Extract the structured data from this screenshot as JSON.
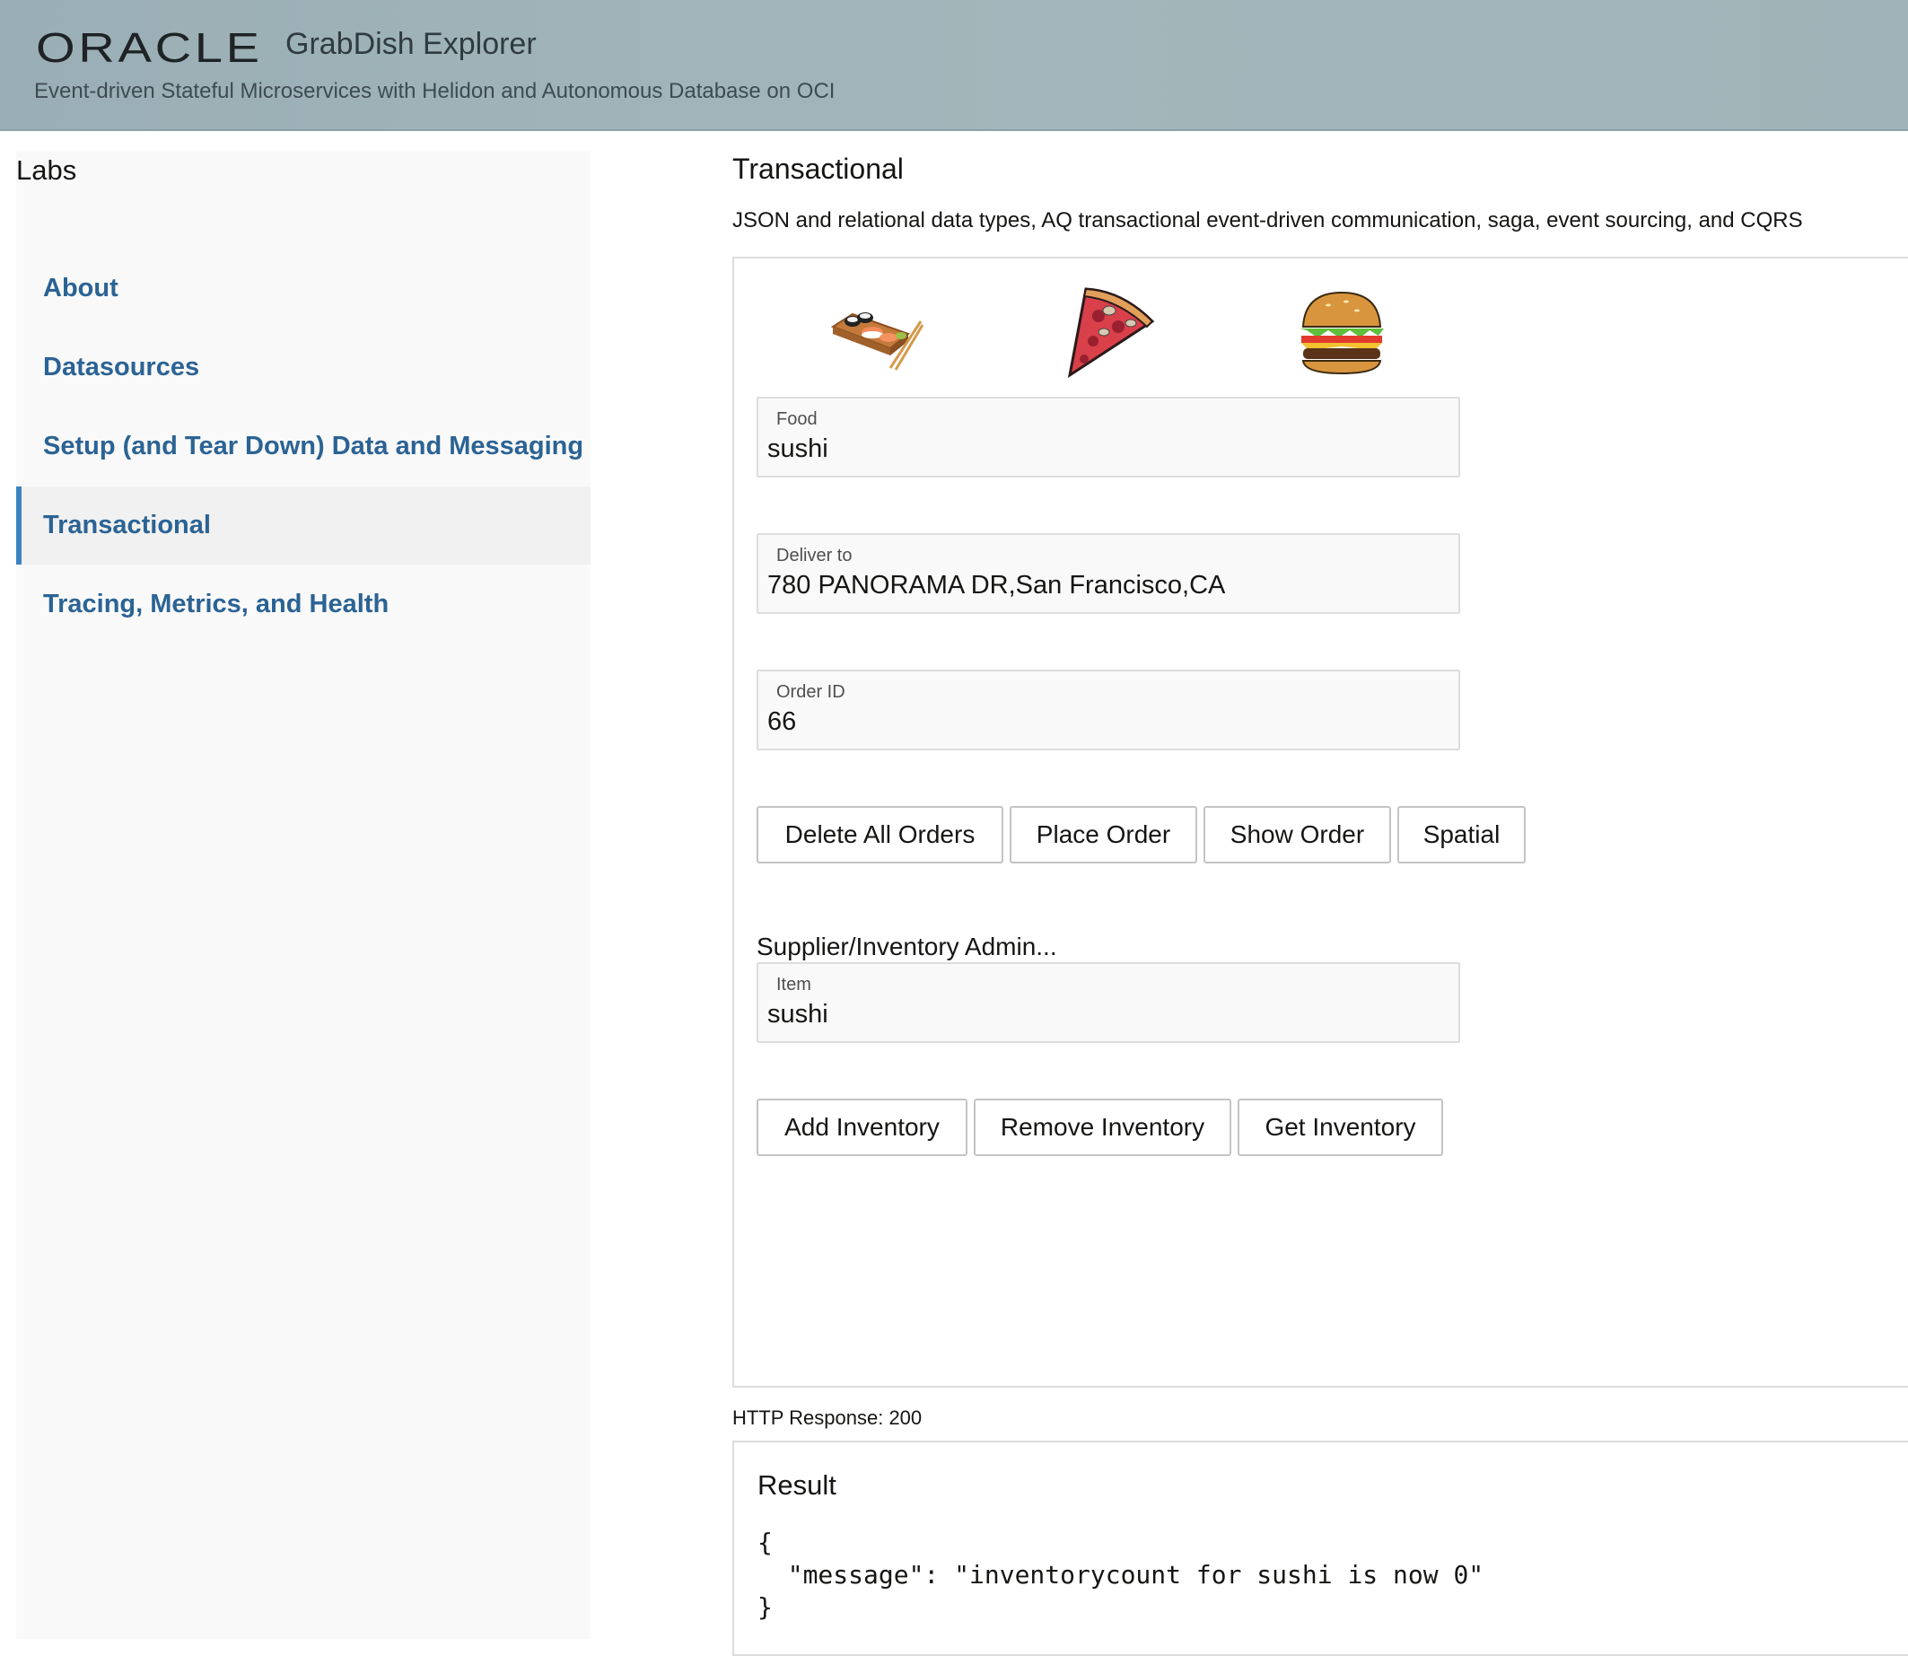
{
  "header": {
    "logo": "ORACLE",
    "app_title": "GrabDish Explorer",
    "subtitle": "Event-driven Stateful Microservices with Helidon and Autonomous Database on OCI"
  },
  "sidebar": {
    "title": "Labs",
    "items": [
      {
        "label": "About",
        "active": false
      },
      {
        "label": "Datasources",
        "active": false
      },
      {
        "label": "Setup (and Tear Down) Data and Messaging",
        "active": false
      },
      {
        "label": "Transactional",
        "active": true
      },
      {
        "label": "Tracing, Metrics, and Health",
        "active": false
      }
    ]
  },
  "main": {
    "title": "Transactional",
    "description": "JSON and relational data types, AQ transactional event-driven communication, saga, event sourcing, and CQRS",
    "food_icons": [
      "sushi-icon",
      "pizza-icon",
      "burger-icon"
    ],
    "fields": {
      "food": {
        "label": "Food",
        "value": "sushi"
      },
      "deliver_to": {
        "label": "Deliver to",
        "value": "780 PANORAMA DR,San Francisco,CA"
      },
      "order_id": {
        "label": "Order ID",
        "value": "66"
      }
    },
    "order_buttons": {
      "delete_all": "Delete All Orders",
      "place": "Place Order",
      "show": "Show Order",
      "spatial": "Spatial"
    },
    "admin": {
      "section_label": "Supplier/Inventory Admin...",
      "item": {
        "label": "Item",
        "value": "sushi"
      },
      "buttons": {
        "add": "Add Inventory",
        "remove": "Remove Inventory",
        "get": "Get Inventory"
      }
    },
    "http_response": "HTTP Response: 200",
    "result": {
      "title": "Result",
      "body": "{\n  \"message\": \"inventorycount for sushi is now 0\"\n}"
    }
  },
  "colors": {
    "header_bg": "#9fb3b8",
    "link": "#2b6394",
    "active_indicator": "#3d83c1"
  }
}
